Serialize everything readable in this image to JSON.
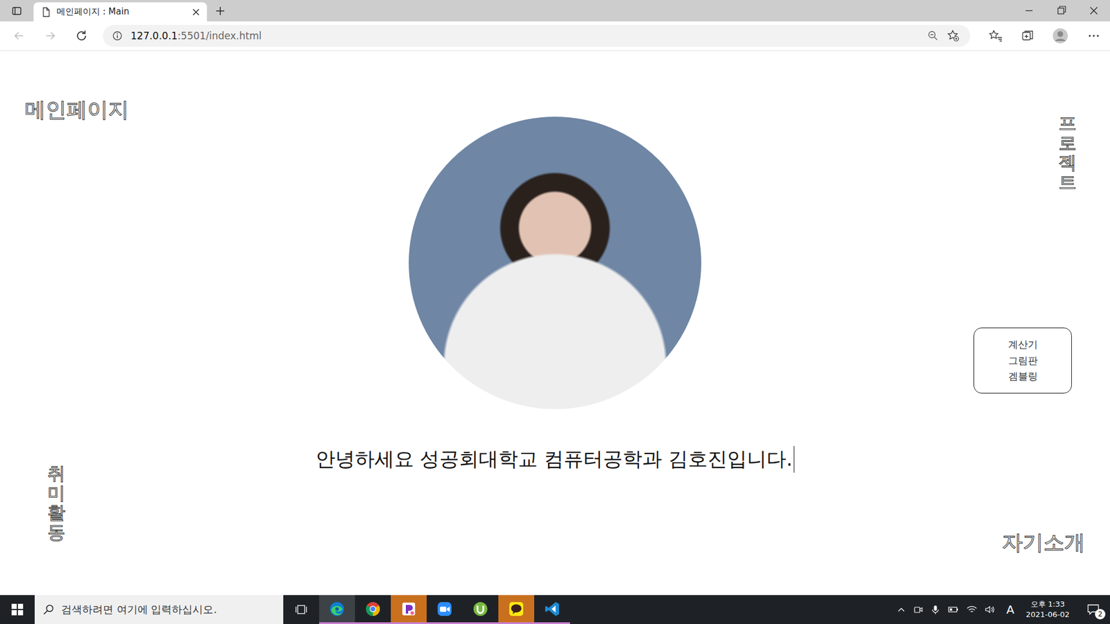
{
  "browser": {
    "tab_title": "메인페이지 : Main",
    "url_host": "127.0.0.1",
    "url_path": ":5501/index.html"
  },
  "page": {
    "top_left": "메인페이지",
    "vertical_left": "취미활동",
    "vertical_right": "프로젝트",
    "bottom_right": "자기소개",
    "greeting": "안녕하세요 성공회대학교 컴퓨터공학과 김호진입니다.",
    "project_links": [
      "계산기",
      "그림판",
      "겜블링"
    ]
  },
  "taskbar": {
    "search_placeholder": "검색하려면 여기에 입력하십시오.",
    "apps": [
      {
        "kind": "edge",
        "running": true,
        "selected": true,
        "flashing": false
      },
      {
        "kind": "chrome",
        "running": true,
        "selected": false,
        "flashing": false
      },
      {
        "kind": "pick",
        "running": true,
        "selected": false,
        "flashing": true
      },
      {
        "kind": "zoom",
        "running": true,
        "selected": false,
        "flashing": false
      },
      {
        "kind": "torrent",
        "running": true,
        "selected": false,
        "flashing": false
      },
      {
        "kind": "kakao",
        "running": true,
        "selected": false,
        "flashing": true
      },
      {
        "kind": "vscode",
        "running": true,
        "selected": false,
        "flashing": false
      }
    ],
    "ime": "A",
    "time": "오후 1:33",
    "date": "2021-06-02",
    "notifications": "2"
  }
}
